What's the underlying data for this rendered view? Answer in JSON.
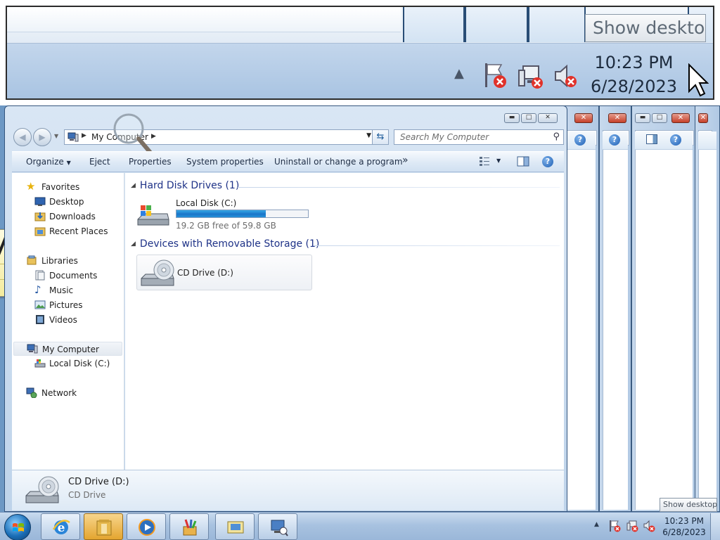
{
  "zoom": {
    "show_desktop": "Show desktop",
    "time": "10:23 PM",
    "date": "6/28/2023"
  },
  "window": {
    "breadcrumb": "My Computer",
    "search_placeholder": "Search My Computer",
    "commands": {
      "organize": "Organize",
      "eject": "Eject",
      "properties": "Properties",
      "system_properties": "System properties",
      "uninstall": "Uninstall or change a program",
      "more": "»"
    }
  },
  "nav": {
    "favorites": "Favorites",
    "desktop": "Desktop",
    "downloads": "Downloads",
    "recent_places": "Recent Places",
    "libraries": "Libraries",
    "documents": "Documents",
    "music": "Music",
    "pictures": "Pictures",
    "videos": "Videos",
    "my_computer": "My Computer",
    "local_disk": "Local Disk (C:)",
    "network": "Network"
  },
  "content": {
    "group_hdd": "Hard Disk Drives (1)",
    "group_removable": "Devices with Removable Storage (1)",
    "local_disk_name": "Local Disk (C:)",
    "local_disk_free": "19.2 GB free of 59.8 GB",
    "local_disk_used_fraction": 0.68,
    "cd_drive_name": "CD Drive (D:)"
  },
  "details": {
    "name": "CD Drive (D:)",
    "type": "CD Drive"
  },
  "taskbar": {
    "time": "10:23 PM",
    "date": "6/28/2023",
    "show_desktop_tooltip": "Show desktop"
  },
  "colors": {
    "accent": "#1e3287",
    "progress": "#1a75c9",
    "close": "#c6402a"
  }
}
